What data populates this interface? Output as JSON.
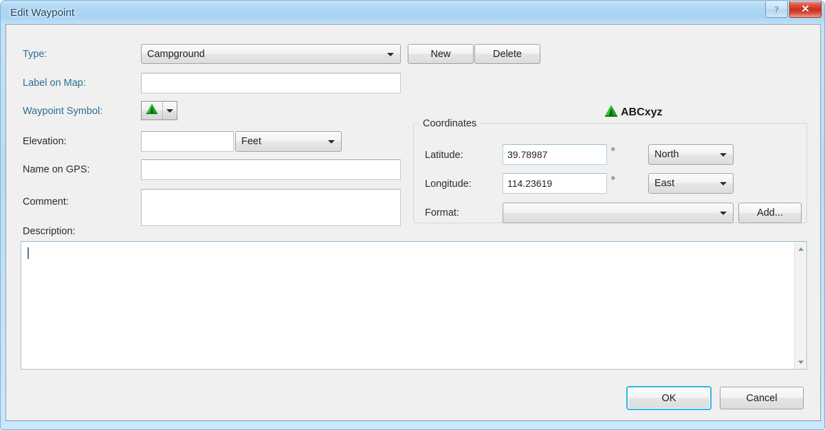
{
  "window": {
    "title": "Edit Waypoint",
    "help_button_glyph": "?",
    "close_button_glyph": "✕"
  },
  "form": {
    "type_label": "Type:",
    "type_value": "Campground",
    "label_on_map_label": "Label on Map:",
    "label_on_map_value": "",
    "waypoint_symbol_label": "Waypoint Symbol:",
    "elevation_label": "Elevation:",
    "elevation_value": "",
    "elevation_units_value": "Feet",
    "name_on_gps_label": "Name on GPS:",
    "name_on_gps_value": "",
    "comment_label": "Comment:",
    "comment_value": "",
    "description_label": "Description:",
    "description_value": ""
  },
  "actions": {
    "new_label": "New",
    "delete_label": "Delete",
    "ok_label": "OK",
    "cancel_label": "Cancel",
    "add_label": "Add..."
  },
  "preview": {
    "sample_text": "ABCxyz"
  },
  "coordinates": {
    "group_title": "Coordinates",
    "latitude_label": "Latitude:",
    "latitude_value": "39.78987",
    "latitude_degree_symbol": "°",
    "latitude_hemisphere": "North",
    "longitude_label": "Longitude:",
    "longitude_value": "114.23619",
    "longitude_degree_symbol": "°",
    "longitude_hemisphere": "East",
    "format_label": "Format:",
    "format_value": ""
  },
  "colors": {
    "titlebar": "#aed7f4",
    "client_bg": "#f0f0f0",
    "blue_label": "#2e6d94",
    "close_button": "#c8301c",
    "default_focus": "#2fb3e8",
    "symbol_green": "#18a019"
  }
}
